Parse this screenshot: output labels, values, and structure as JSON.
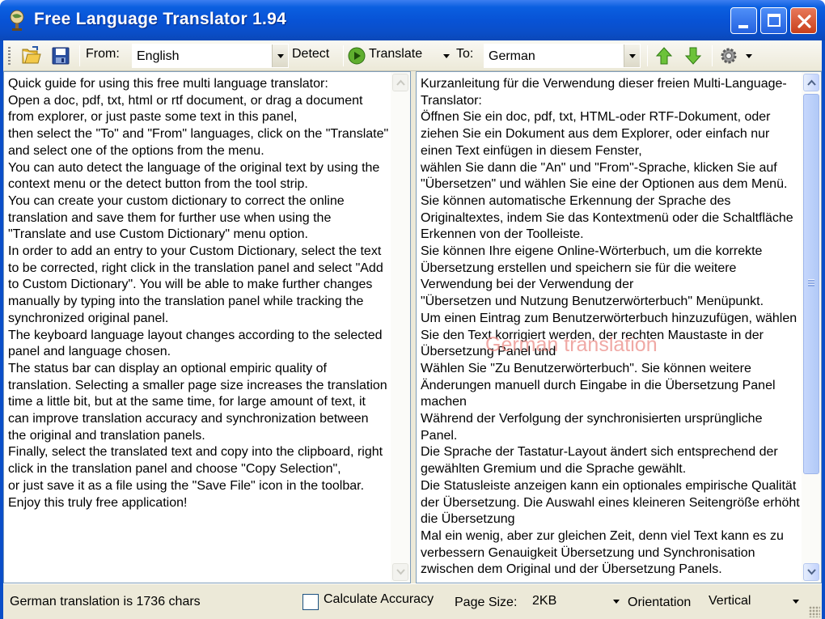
{
  "window": {
    "title": "Free Language Translator 1.94"
  },
  "toolbar": {
    "open_icon": "open-folder-icon",
    "save_icon": "save-floppy-icon",
    "from_label": "From:",
    "from_value": "English",
    "detect_label": "Detect",
    "translate_label": "Translate",
    "to_label": "To:",
    "to_value": "German",
    "up_icon": "arrow-up-icon",
    "down_icon": "arrow-down-icon",
    "settings_icon": "gear-icon"
  },
  "source_panel": {
    "text": "Quick guide for using this free multi language translator:\nOpen a doc, pdf, txt, html or rtf document, or drag a document from explorer, or just paste some text in this panel,\nthen select the \"To\" and \"From\" languages, click on the \"Translate\" and select one of the options from the menu.\nYou can auto detect the language of the original text by using the context menu or the detect button from the tool strip.\nYou can create your custom dictionary to correct the online translation and save them for further use when using the \"Translate and use Custom Dictionary\" menu option.\nIn order to add an entry to your Custom Dictionary, select the text to be corrected, right click in the translation panel and select \"Add to Custom Dictionary\". You will be able to make further changes manually by typing into the translation panel while tracking the synchronized original panel.\nThe keyboard language layout changes according to the selected panel and language chosen.\nThe status bar can display an optional empiric quality of translation. Selecting a smaller page size increases the translation\ntime a little bit, but at the same time, for large amount of text, it can improve translation accuracy and synchronization between the original and translation panels.\nFinally, select the translated text and copy into the clipboard, right click in the translation panel and choose \"Copy Selection\",\nor just save it as a file using the \"Save File\" icon in the toolbar.\nEnjoy this truly free application!"
  },
  "target_panel": {
    "text": "Kurzanleitung für die Verwendung dieser freien Multi-Language-Translator:\nÖffnen Sie ein doc, pdf, txt, HTML-oder RTF-Dokument, oder ziehen Sie ein Dokument aus dem Explorer, oder einfach nur einen Text einfügen in diesem Fenster,\nwählen Sie dann die \"An\" und \"From\"-Sprache, klicken Sie auf \"Übersetzen\" und wählen Sie eine der Optionen aus dem Menü.\nSie können automatische Erkennung der Sprache des Originaltextes, indem Sie das Kontextmenü oder die Schaltfläche Erkennen von der Toolleiste.\nSie können Ihre eigene Online-Wörterbuch, um die korrekte Übersetzung erstellen und speichern sie für die weitere Verwendung bei der Verwendung der\n\"Übersetzen und Nutzung Benutzerwörterbuch\" Menüpunkt.\nUm einen Eintrag zum Benutzerwörterbuch hinzuzufügen, wählen Sie den Text korrigiert werden, der rechten Maustaste in der Übersetzung Panel und\nWählen Sie \"Zu Benutzerwörterbuch\". Sie können weitere Änderungen manuell durch Eingabe in die Übersetzung Panel machen\nWährend der Verfolgung der synchronisierten ursprüngliche Panel.\nDie Sprache der Tastatur-Layout ändert sich entsprechend der gewählten Gremium und die Sprache gewählt.\nDie Statusleiste anzeigen kann ein optionales empirische Qualität der Übersetzung. Die Auswahl eines kleineren Seitengröße erhöht die Übersetzung\nMal ein wenig, aber zur gleichen Zeit, denn viel Text kann es zu verbessern Genauigkeit Übersetzung und Synchronisation zwischen dem Original und der Übersetzung Panels.",
    "watermark": "German translation"
  },
  "statusbar": {
    "char_count": "German translation is 1736 chars",
    "calc_accuracy_label": "Calculate Accuracy",
    "calc_accuracy_checked": false,
    "page_size_label": "Page Size:",
    "page_size_value": "2KB",
    "orientation_label": "Orientation",
    "orientation_value": "Vertical"
  },
  "colors": {
    "titlebar": "#0853d6",
    "chrome": "#ece9d8",
    "watermark": "#eb8c87",
    "panel_border": "#7f9db9"
  }
}
